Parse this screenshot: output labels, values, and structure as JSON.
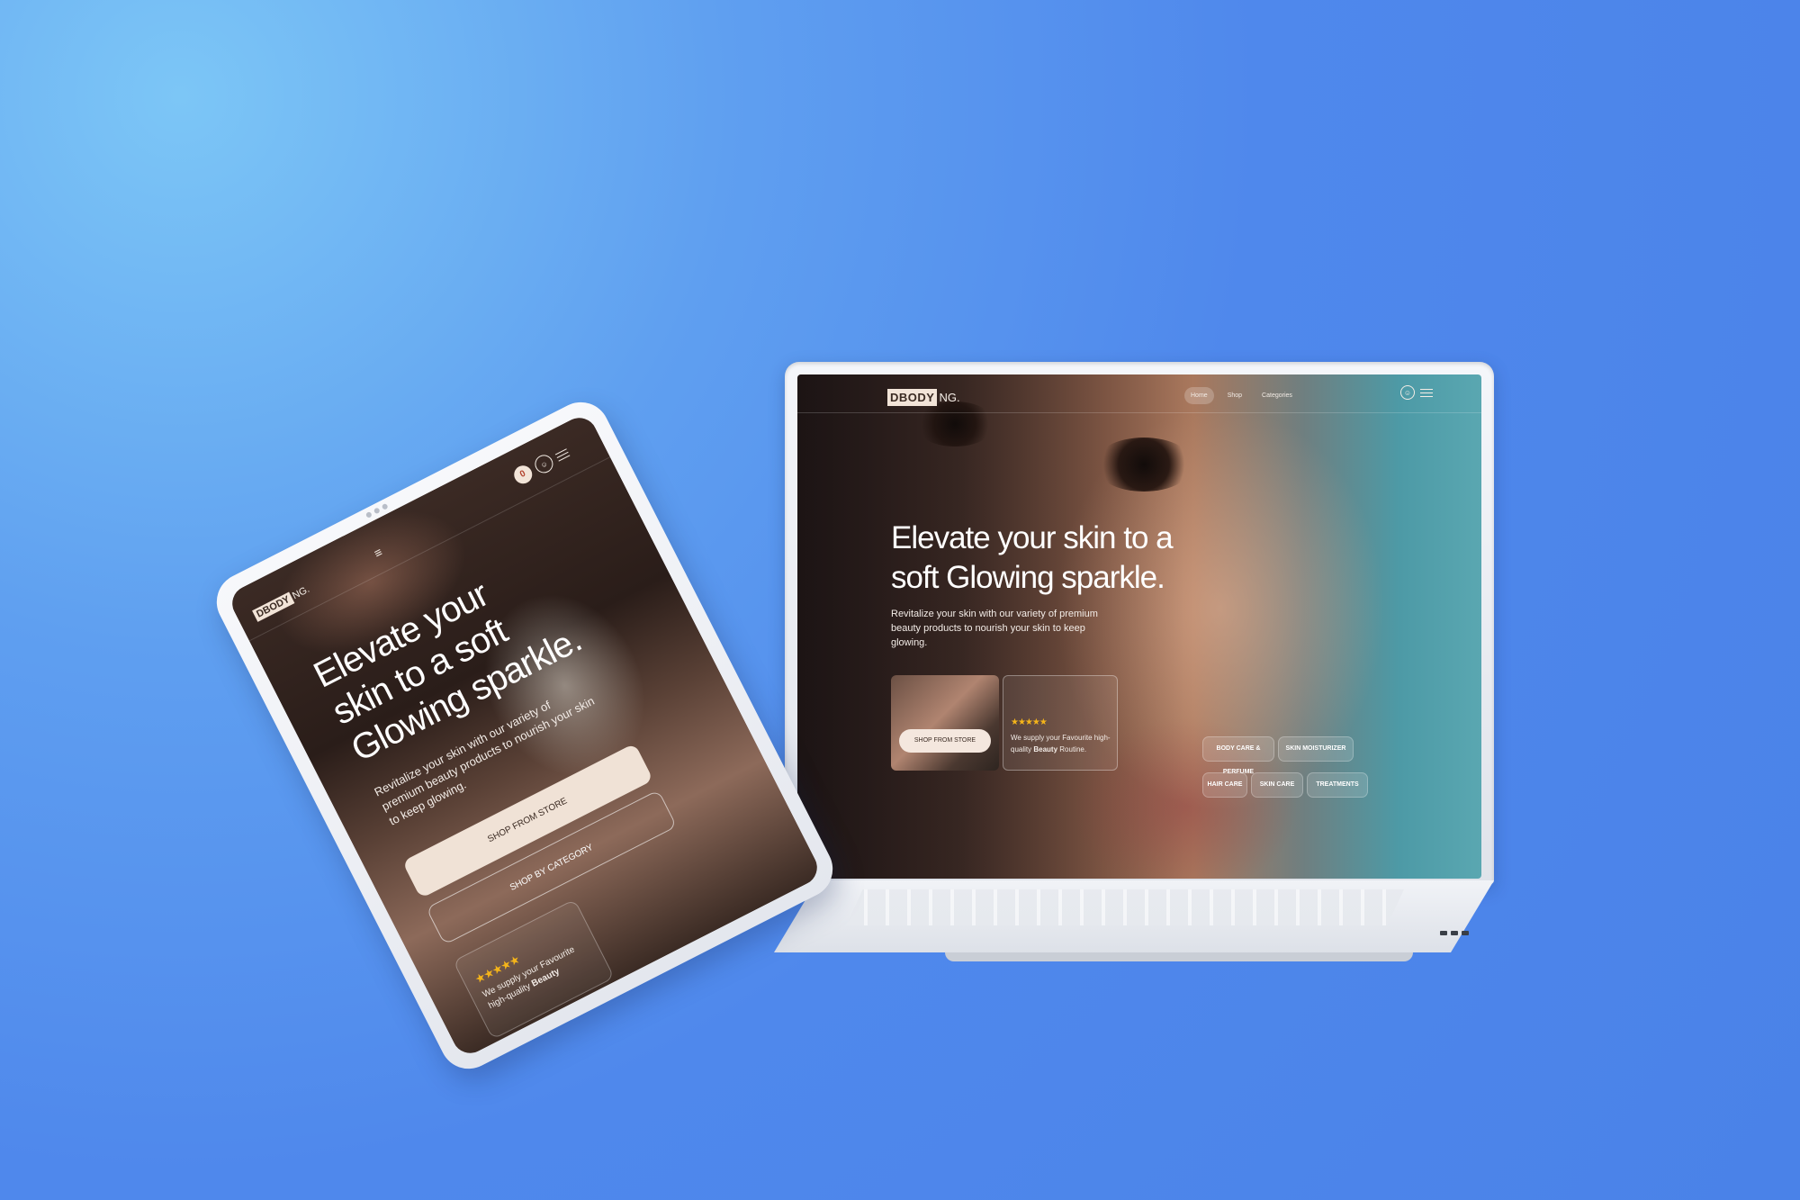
{
  "site": {
    "logo_box": "DBODY",
    "logo_rest": "NG.",
    "nav": {
      "home": "Home",
      "shop": "Shop",
      "categories": "Categories"
    },
    "hero_title": "Elevate your skin to a soft Glowing sparkle.",
    "hero_subtitle": "Revitalize your skin with our variety of premium beauty products to nourish your skin to keep glowing.",
    "shop_from_store": "SHOP FROM STORE",
    "shop_by_category": "SHOP BY CATEGORY",
    "rating_stars": "★★★★★",
    "rating_text_prefix": "We supply your Favourite high-quality",
    "rating_text_bold": "Beauty",
    "rating_text_suffix": "Routine.",
    "categories": {
      "body_care": "BODY CARE & PERFUME",
      "skin_moisturizer": "SKIN MOISTURIZER",
      "hair_care": "HAIR CARE",
      "skin_care": "SKIN CARE",
      "treatments": "TREATMENTS"
    },
    "icons": {
      "user": "user-icon",
      "menu": "menu-icon",
      "cart": "cart-icon"
    },
    "cart_count": "0"
  },
  "colors": {
    "background": "#4f88ec",
    "button_cream": "#f4e7de",
    "star": "#f4b41a",
    "logo_box": "#f2e4d8"
  }
}
